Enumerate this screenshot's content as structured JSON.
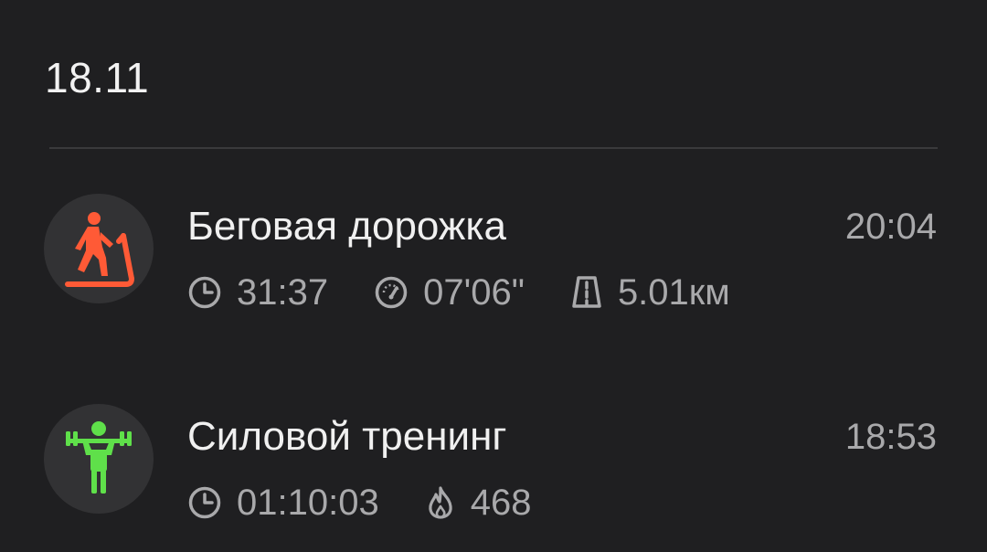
{
  "date_header": "18.11",
  "colors": {
    "background": "#1f1f21",
    "icon_bg": "#323234",
    "treadmill_accent": "#ff5a36",
    "strength_accent": "#5fe04a",
    "secondary_text": "#a9a9ab"
  },
  "workouts": [
    {
      "icon": "treadmill-icon",
      "title": "Беговая дорожка",
      "time": "20:04",
      "stats": [
        {
          "icon": "clock-icon",
          "value": "31:37"
        },
        {
          "icon": "speedometer-icon",
          "value": "07'06\""
        },
        {
          "icon": "road-icon",
          "value": "5.01км"
        }
      ]
    },
    {
      "icon": "weightlifting-icon",
      "title": "Силовой тренинг",
      "time": "18:53",
      "stats": [
        {
          "icon": "clock-icon",
          "value": "01:10:03"
        },
        {
          "icon": "flame-icon",
          "value": "468"
        }
      ]
    }
  ]
}
